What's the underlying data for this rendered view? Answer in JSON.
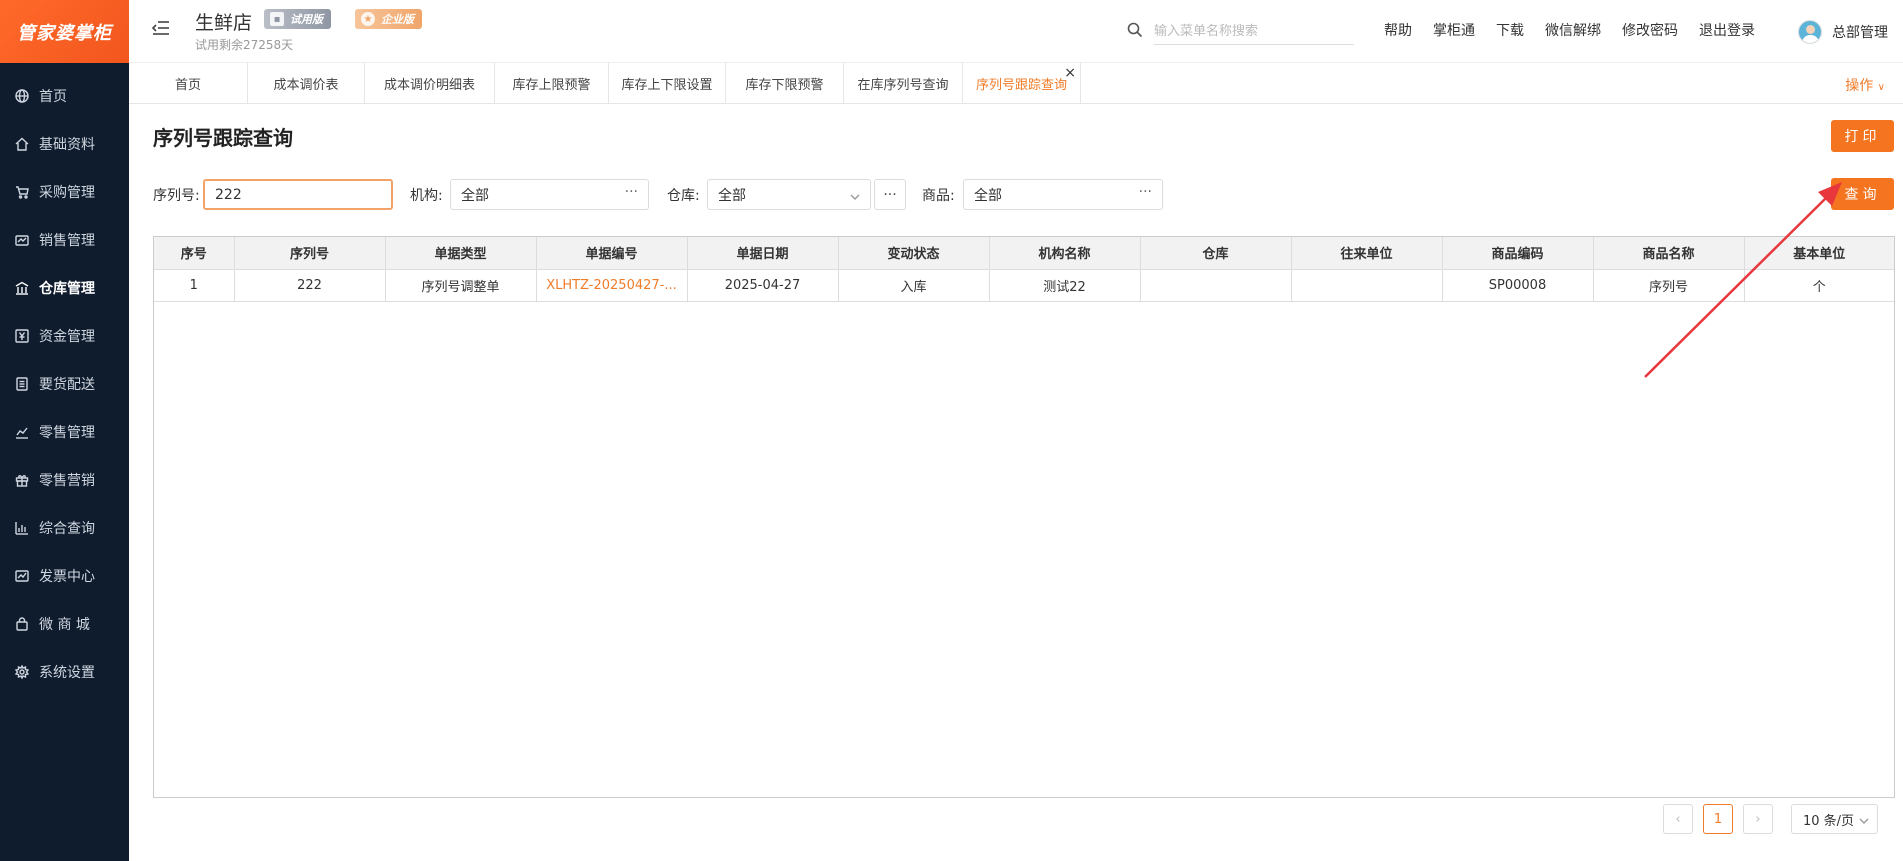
{
  "app": {
    "logo_text": "管家婆掌柜",
    "store_name": "生鲜店",
    "trial_remaining": "试用剩余27258天",
    "badge_trial": "试用版",
    "badge_enterprise": "企业版"
  },
  "sidebar": {
    "items": [
      {
        "label": "首页",
        "icon": "globe-icon"
      },
      {
        "label": "基础资料",
        "icon": "home-icon"
      },
      {
        "label": "采购管理",
        "icon": "cart-icon"
      },
      {
        "label": "销售管理",
        "icon": "sales-icon"
      },
      {
        "label": "仓库管理",
        "icon": "warehouse-icon",
        "active": true
      },
      {
        "label": "资金管理",
        "icon": "yuan-icon"
      },
      {
        "label": "要货配送",
        "icon": "list-icon"
      },
      {
        "label": "零售管理",
        "icon": "chart-icon"
      },
      {
        "label": "零售营销",
        "icon": "gift-icon"
      },
      {
        "label": "综合查询",
        "icon": "bar-chart-icon"
      },
      {
        "label": "发票中心",
        "icon": "trend-icon"
      },
      {
        "label": "微 商 城",
        "icon": "bag-icon"
      },
      {
        "label": "系统设置",
        "icon": "gear-icon"
      }
    ]
  },
  "header": {
    "search_placeholder": "输入菜单名称搜索",
    "links": [
      "帮助",
      "掌柜通",
      "下载",
      "微信解绑",
      "修改密码",
      "退出登录"
    ],
    "user_name": "总部管理"
  },
  "tabs": {
    "items": [
      "首页",
      "成本调价表",
      "成本调价明细表",
      "库存上限预警",
      "库存上下限设置",
      "库存下限预警",
      "在库序列号查询",
      "序列号跟踪查询"
    ],
    "active_index": 7,
    "close_symbol": "×",
    "operation_label": "操作"
  },
  "page": {
    "title": "序列号跟踪查询",
    "print_button": "打印",
    "query_button": "查询"
  },
  "filters": {
    "serial_label": "序列号:",
    "serial_value": "222",
    "org_label": "机构:",
    "org_value": "全部",
    "warehouse_label": "仓库:",
    "warehouse_value": "全部",
    "product_label": "商品:",
    "product_value": "全部",
    "dots": "···"
  },
  "table": {
    "columns": [
      "序号",
      "序列号",
      "单据类型",
      "单据编号",
      "单据日期",
      "变动状态",
      "机构名称",
      "仓库",
      "往来单位",
      "商品编码",
      "商品名称",
      "基本单位"
    ],
    "rows": [
      [
        "1",
        "222",
        "序列号调整单",
        "XLHTZ-20250427-...",
        "2025-04-27",
        "入库",
        "测试22",
        "",
        "",
        "SP00008",
        "序列号",
        "个"
      ]
    ]
  },
  "pagination": {
    "prev": "‹",
    "current_page": "1",
    "next": "›",
    "page_size": "10 条/页"
  },
  "colors": {
    "accent": "#f5741f",
    "sidebar_bg": "#0f1c2e",
    "annotation_arrow": "#e8383d"
  }
}
